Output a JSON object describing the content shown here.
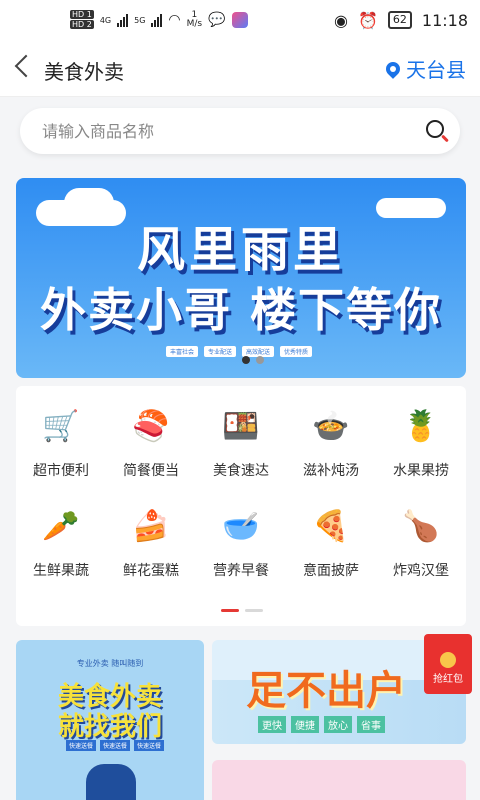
{
  "status_bar": {
    "hd1": "HD 1",
    "hd2": "HD 2",
    "net1": "4G",
    "net2": "5G",
    "speed_value": "1",
    "speed_unit": "M/s",
    "battery": "62",
    "time": "11:18"
  },
  "nav": {
    "title": "美食外卖",
    "location": "天台县"
  },
  "search": {
    "placeholder": "请输入商品名称"
  },
  "banner": {
    "line1": "风里雨里",
    "line2": "外卖小哥 楼下等你",
    "tags": [
      "丰富社会",
      "专业配送",
      "高效配送",
      "优秀特质"
    ],
    "active_dot_color": "#333333",
    "inactive_dot_color": "#999999"
  },
  "categories": [
    {
      "label": "超市便利",
      "icon": "shopping-cart-icon"
    },
    {
      "label": "简餐便当",
      "icon": "sushi-roll-icon"
    },
    {
      "label": "美食速达",
      "icon": "food-box-icon"
    },
    {
      "label": "滋补炖汤",
      "icon": "soup-bowl-icon"
    },
    {
      "label": "水果果捞",
      "icon": "fruit-basket-icon"
    },
    {
      "label": "生鲜果蔬",
      "icon": "vegetables-icon"
    },
    {
      "label": "鲜花蛋糕",
      "icon": "cake-icon"
    },
    {
      "label": "营养早餐",
      "icon": "breakfast-bowl-icon"
    },
    {
      "label": "意面披萨",
      "icon": "pizza-slice-icon"
    },
    {
      "label": "炸鸡汉堡",
      "icon": "fried-chicken-icon"
    }
  ],
  "page_indicator": {
    "active_color": "#e53935",
    "inactive_color": "#d9d9d9"
  },
  "promos": {
    "promo1": {
      "subtitle": "专业外卖 随叫随到",
      "title_line1": "美食外卖",
      "title_line2": "就找我们",
      "buttons": [
        "快速送餐",
        "快速送餐",
        "快速送餐"
      ]
    },
    "promo2": {
      "title": "足不出户",
      "tags": [
        "更快",
        "便捷",
        "放心",
        "省事"
      ]
    },
    "red_packet": "抢红包"
  },
  "colors": {
    "accent_blue": "#1a73e8",
    "banner_blue": "#2f8df2",
    "red": "#e8312f"
  }
}
